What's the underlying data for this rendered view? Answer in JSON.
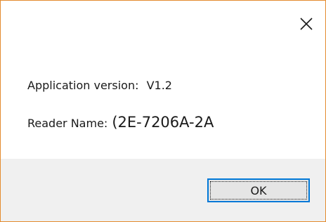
{
  "dialog": {
    "close_icon": "close-icon",
    "accent_border_color": "#e48b2e",
    "footer_color": "#f0f0f0",
    "focus_color": "#0078d7"
  },
  "info": {
    "version_label": "Application version",
    "version_sep": ":",
    "version_value": "V1.2",
    "reader_label": "Reader Name",
    "reader_sep": ":",
    "reader_value": "(2E-7206A-2A"
  },
  "footer": {
    "ok_label": "OK"
  }
}
